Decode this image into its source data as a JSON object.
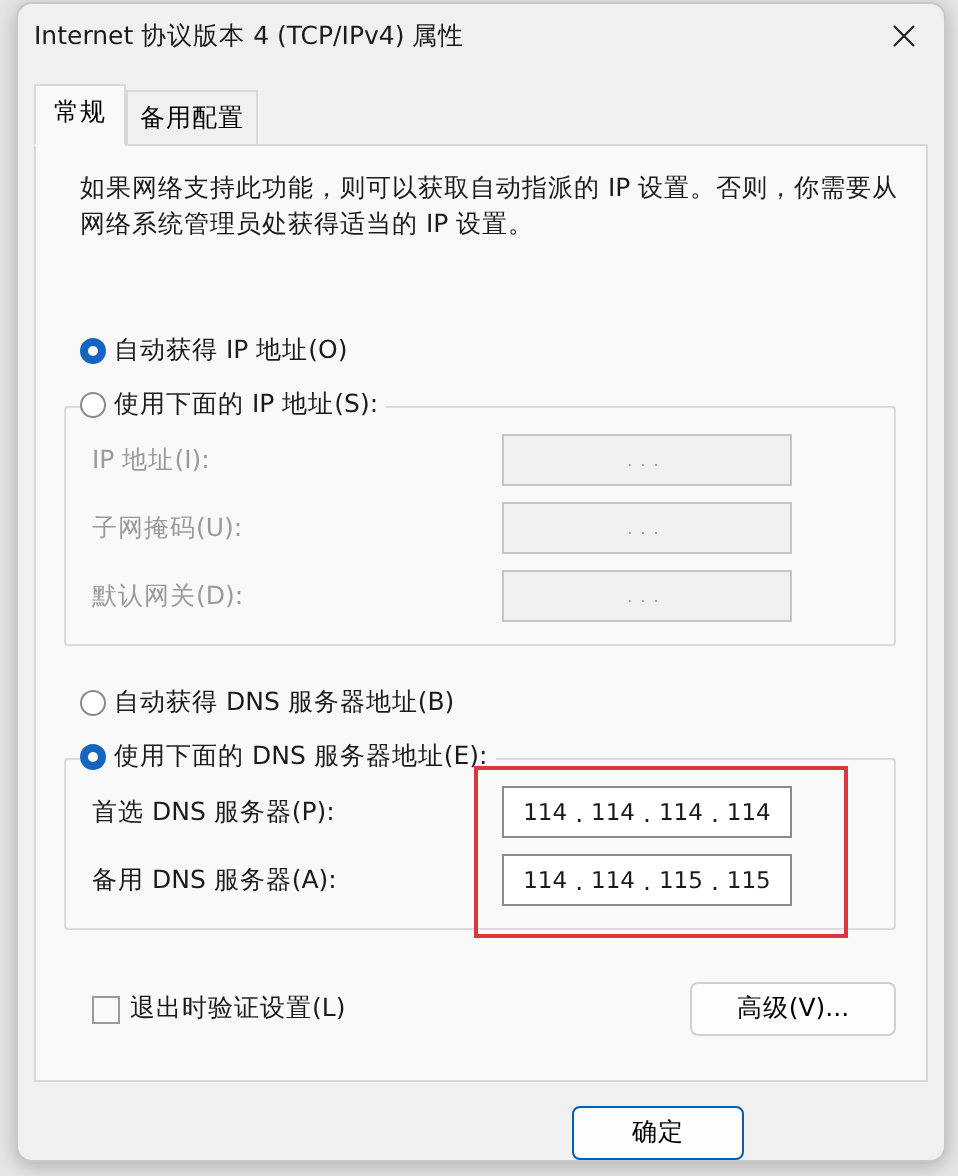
{
  "window": {
    "title": "Internet 协议版本 4 (TCP/IPv4) 属性"
  },
  "tabs": [
    {
      "label": "常规",
      "selected": true
    },
    {
      "label": "备用配置",
      "selected": false
    }
  ],
  "description": "如果网络支持此功能，则可以获取自动指派的 IP 设置。否则，你需要从网络系统管理员处获得适当的 IP 设置。",
  "ip_separator": ".",
  "ip_section": {
    "auto_option": {
      "label": "自动获得 IP 地址(O)",
      "selected": true
    },
    "manual_option": {
      "label": "使用下面的 IP 地址(S):",
      "selected": false
    },
    "fields": [
      {
        "label": "IP 地址(I):",
        "disabled": true
      },
      {
        "label": "子网掩码(U):",
        "disabled": true
      },
      {
        "label": "默认网关(D):",
        "disabled": true
      }
    ]
  },
  "dns_section": {
    "auto_option": {
      "label": "自动获得 DNS 服务器地址(B)",
      "selected": false
    },
    "manual_option": {
      "label": "使用下面的 DNS 服务器地址(E):",
      "selected": true
    },
    "highlighted": true,
    "fields": [
      {
        "label": "首选 DNS 服务器(P):",
        "disabled": false,
        "octets": [
          "114",
          "114",
          "114",
          "114"
        ]
      },
      {
        "label": "备用 DNS 服务器(A):",
        "disabled": false,
        "octets": [
          "114",
          "114",
          "115",
          "115"
        ]
      }
    ]
  },
  "validate_checkbox": {
    "label": "退出时验证设置(L)",
    "checked": false
  },
  "advanced_button": "高级(V)...",
  "buttons": [
    "确定"
  ]
}
